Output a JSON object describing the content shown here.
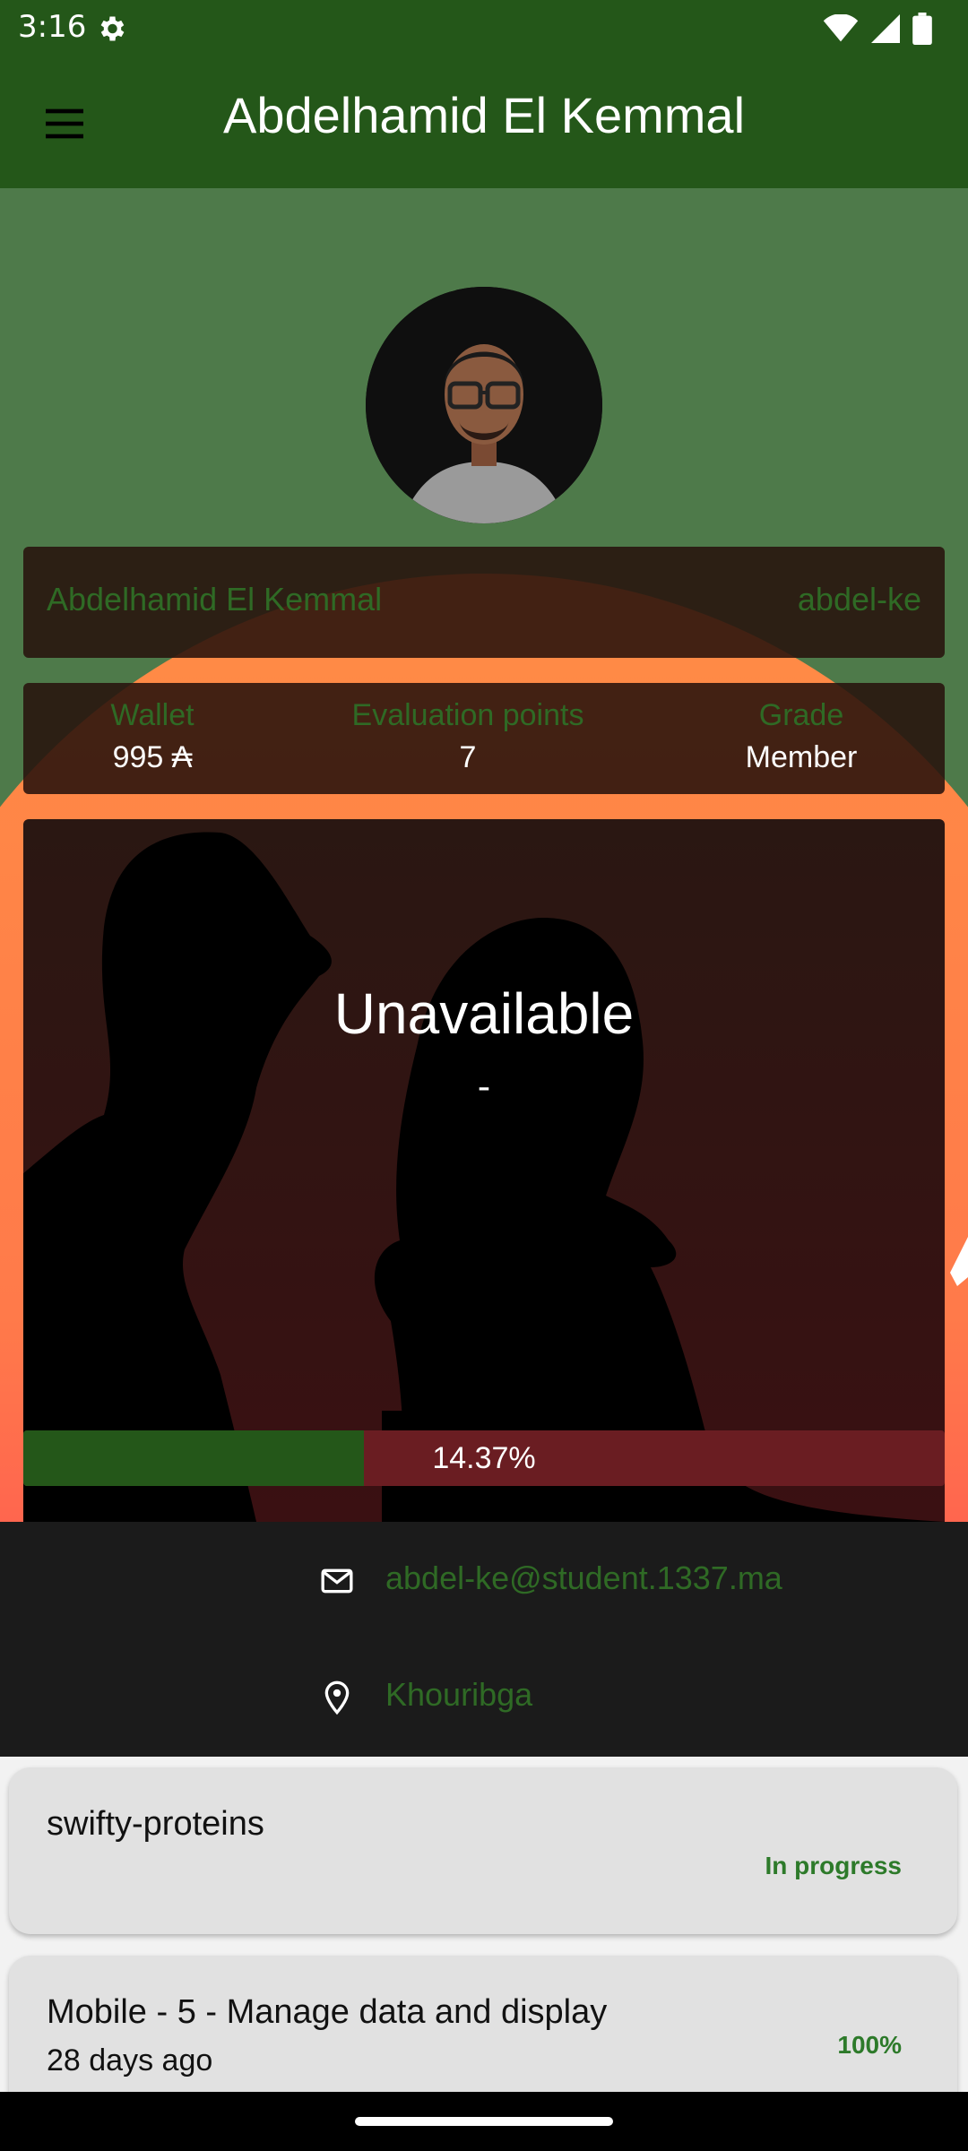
{
  "status_bar": {
    "time": "3:16",
    "icons": [
      "gear-icon",
      "wifi-icon",
      "signal-icon",
      "battery-icon"
    ]
  },
  "app_bar": {
    "title": "Abdelhamid El Kemmal",
    "menu_icon": "menu-icon"
  },
  "profile": {
    "full_name": "Abdelhamid El Kemmal",
    "login": "abdel-ke",
    "stats": [
      {
        "label": "Wallet",
        "value": "995 ₳"
      },
      {
        "label": "Evaluation points",
        "value": "7"
      },
      {
        "label": "Grade",
        "value": "Member"
      }
    ],
    "coalition": {
      "name": "Unavailable",
      "subtitle": "-"
    },
    "level": {
      "text": "14.37%",
      "progress": 0.37
    }
  },
  "contact": {
    "email": "abdel-ke@student.1337.ma",
    "location": "Khouribga"
  },
  "projects": [
    {
      "name": "swifty-proteins",
      "status": "In progress",
      "date": ""
    },
    {
      "name": "Mobile - 5 - Manage data and display",
      "status": "100%",
      "date": "28 days ago"
    }
  ],
  "colors": {
    "primary": "#245719",
    "banner_green": "#4e7a4a",
    "sun_orange": "#ff8c45",
    "level_track": "#6a1d22",
    "label_green": "#2f6a25",
    "status_green": "#2d7a2a"
  }
}
